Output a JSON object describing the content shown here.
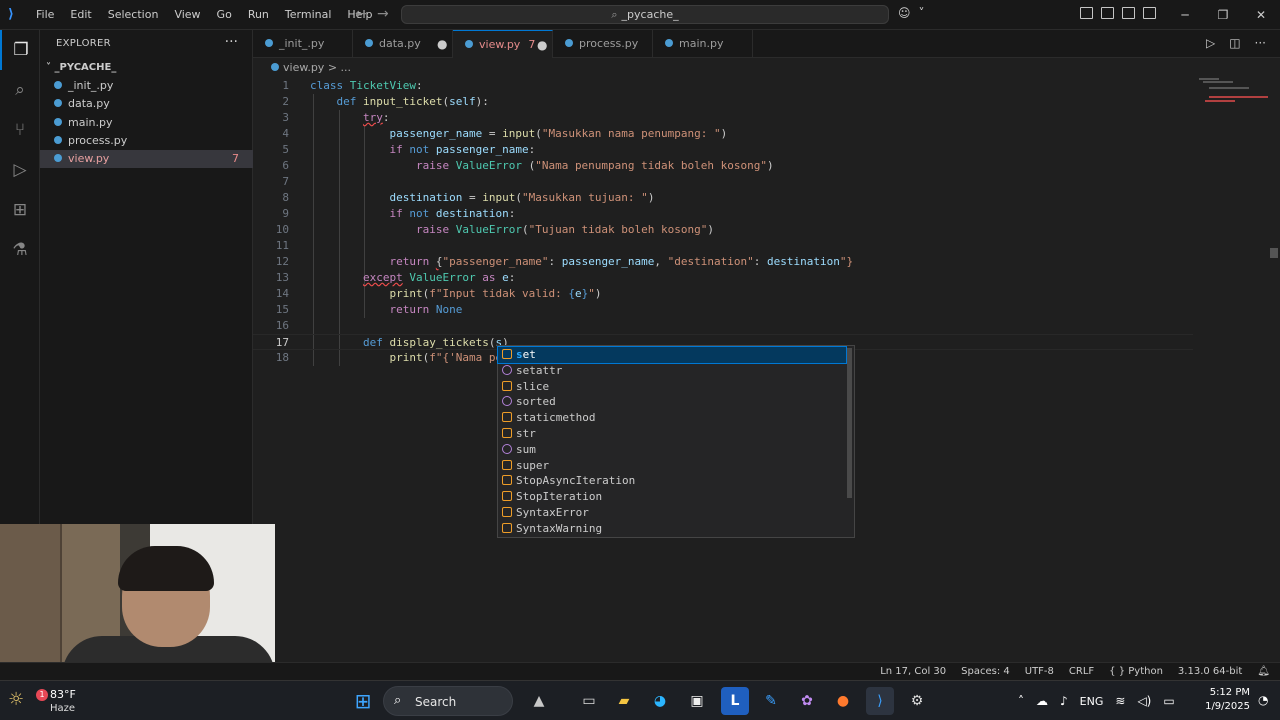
{
  "titlebar": {
    "menu": [
      "File",
      "Edit",
      "Selection",
      "View",
      "Go",
      "Run",
      "Terminal",
      "Help"
    ],
    "search_text": "_pycache_"
  },
  "sidebar": {
    "title": "EXPLORER",
    "more": "···",
    "folder": "_PYCACHE_",
    "files": [
      {
        "name": "_init_.py",
        "active": false
      },
      {
        "name": "data.py",
        "active": false
      },
      {
        "name": "main.py",
        "active": false
      },
      {
        "name": "process.py",
        "active": false
      },
      {
        "name": "view.py",
        "active": true,
        "problems": "7"
      }
    ]
  },
  "tabs": [
    {
      "label": "_init_.py"
    },
    {
      "label": "data.py",
      "modified": "●"
    },
    {
      "label": "view.py",
      "problems": "7",
      "modified": "●",
      "active": true
    },
    {
      "label": "process.py"
    },
    {
      "label": "main.py"
    }
  ],
  "breadcrumb": {
    "file": "view.py",
    "sep": "> ..."
  },
  "editor": {
    "lines": [
      {
        "n": "1",
        "text": "class TicketView:"
      },
      {
        "n": "2",
        "text": "    def input_ticket(self):"
      },
      {
        "n": "3",
        "text": "        try:"
      },
      {
        "n": "4",
        "text": "            passenger_name = input(\"Masukkan nama penumpang: \")"
      },
      {
        "n": "5",
        "text": "            if not passenger_name:"
      },
      {
        "n": "6",
        "text": "                raise ValueError (\"Nama penumpang tidak boleh kosong\")"
      },
      {
        "n": "7",
        "text": ""
      },
      {
        "n": "8",
        "text": "            destination = input(\"Masukkan tujuan: \")"
      },
      {
        "n": "9",
        "text": "            if not destination:"
      },
      {
        "n": "10",
        "text": "                raise ValueError(\"Tujuan tidak boleh kosong\")"
      },
      {
        "n": "11",
        "text": ""
      },
      {
        "n": "12",
        "text": "            return {\"passenger_name\": passenger_name, \"destination\": destination\"}"
      },
      {
        "n": "13",
        "text": "        except ValueError as e:"
      },
      {
        "n": "14",
        "text": "            print(f\"Input tidak valid: {e}\")"
      },
      {
        "n": "15",
        "text": "            return None"
      },
      {
        "n": "16",
        "text": ""
      },
      {
        "n": "17",
        "text": "        def display_tickets(s)"
      },
      {
        "n": "18",
        "text": "            print(f\"{'Nama pe"
      }
    ]
  },
  "suggestions": [
    {
      "label": "set",
      "kind": "class",
      "selected": true
    },
    {
      "label": "setattr",
      "kind": "function"
    },
    {
      "label": "slice",
      "kind": "class"
    },
    {
      "label": "sorted",
      "kind": "function"
    },
    {
      "label": "staticmethod",
      "kind": "class"
    },
    {
      "label": "str",
      "kind": "class"
    },
    {
      "label": "sum",
      "kind": "function"
    },
    {
      "label": "super",
      "kind": "class"
    },
    {
      "label": "StopAsyncIteration",
      "kind": "class"
    },
    {
      "label": "StopIteration",
      "kind": "class"
    },
    {
      "label": "SyntaxError",
      "kind": "class"
    },
    {
      "label": "SyntaxWarning",
      "kind": "class"
    }
  ],
  "statusbar": {
    "position": "Ln 17, Col 30",
    "spaces": "Spaces: 4",
    "encoding": "UTF-8",
    "eol": "CRLF",
    "language": "{ } Python",
    "interpreter": "3.13.0 64-bit"
  },
  "taskbar": {
    "weather_temp": "83°F",
    "weather_cond": "Haze",
    "weather_badge": "1",
    "search_label": "Search",
    "language": "ENG",
    "time": "5:12 PM",
    "date": "1/9/2025"
  },
  "colors": {
    "accent": "#0078d4",
    "error": "#f14c4c",
    "keyword": "#569cd6",
    "string": "#ce9178"
  }
}
